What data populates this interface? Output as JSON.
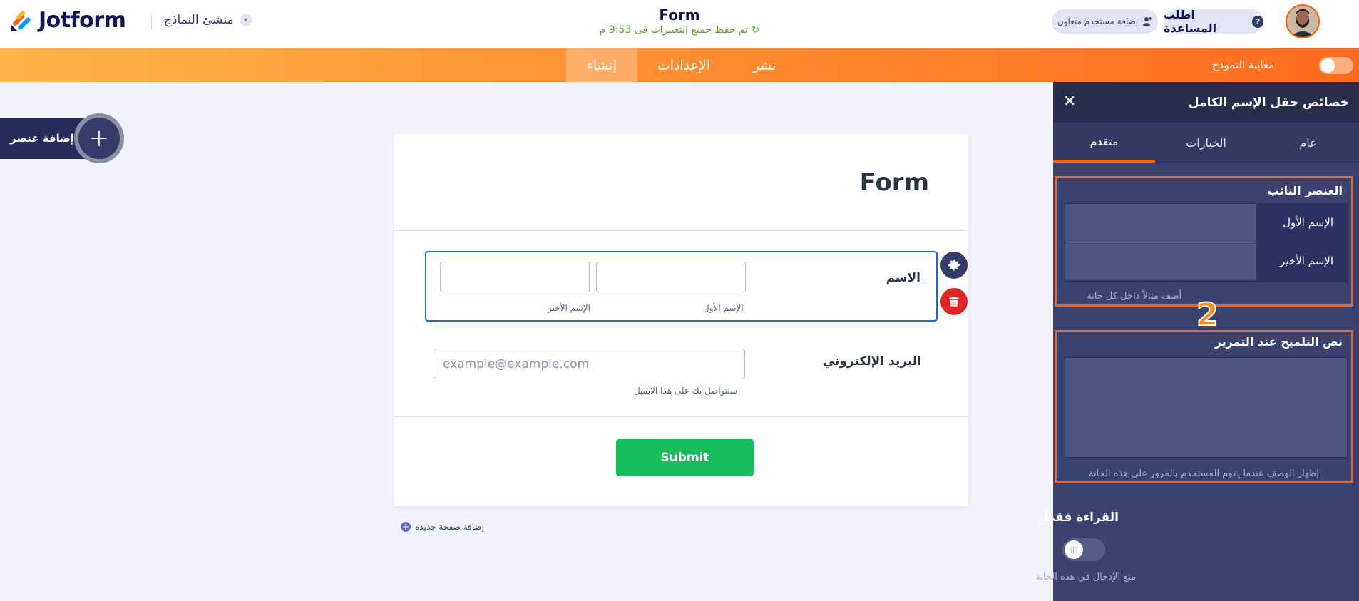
{
  "header": {
    "logo_text": "Jotform",
    "builder_label": "منشئ النماذج",
    "form_title": "Form",
    "saved_status": "تم حفظ جميع التغييرات فى 9:53 م",
    "help_button": "اطلب المساعدة",
    "help_icon": "?",
    "collab_button": "إضافة مستخدم متعاون"
  },
  "navbar": {
    "tabs": [
      {
        "label": "إنشاء",
        "active": true
      },
      {
        "label": "الإعدادات",
        "active": false
      },
      {
        "label": "نشر",
        "active": false
      }
    ],
    "preview_label": "معاينة النموذج"
  },
  "add_element": {
    "label": "إضافة عنصر",
    "plus": "+"
  },
  "form": {
    "heading": "Form",
    "name_field": {
      "label": "الاسم",
      "first_sublabel": "الإسم الأول",
      "last_sublabel": "الإسم الأخير"
    },
    "email_field": {
      "label": "البريد الإلكتروني",
      "placeholder": "example@example.com",
      "sublabel": "سنتواصل بك على هذا الايميل"
    },
    "submit_label": "Submit",
    "add_page_label": "إضافة صفحة جديدة"
  },
  "panel": {
    "title": "خصائص حقل الإسم الكامل",
    "tabs": [
      "متقدم",
      "الخيارات",
      "عام"
    ],
    "sublabels_section": {
      "title": "العنصر النائب",
      "rows": [
        "الإسم الأول",
        "الإسم الأخير"
      ],
      "help": "أضف مثالاً داخل كل خانة"
    },
    "marker": "2",
    "hover_section": {
      "title": "نص التلميح عند التمرير",
      "help": "إظهار الوصف عندما يقوم المستخدم بالمرور على هذه الخانة"
    },
    "readonly_section": {
      "title": "القراءة فقط",
      "help": "منع الإدخال في هذه الخانة"
    }
  },
  "colors": {
    "accent": "#ff6100",
    "nav_bg": "#ff7e29",
    "panel_bg": "#3b4270",
    "submit": "#18bd5b",
    "delete": "#dc2626",
    "status_green": "#58a626"
  }
}
